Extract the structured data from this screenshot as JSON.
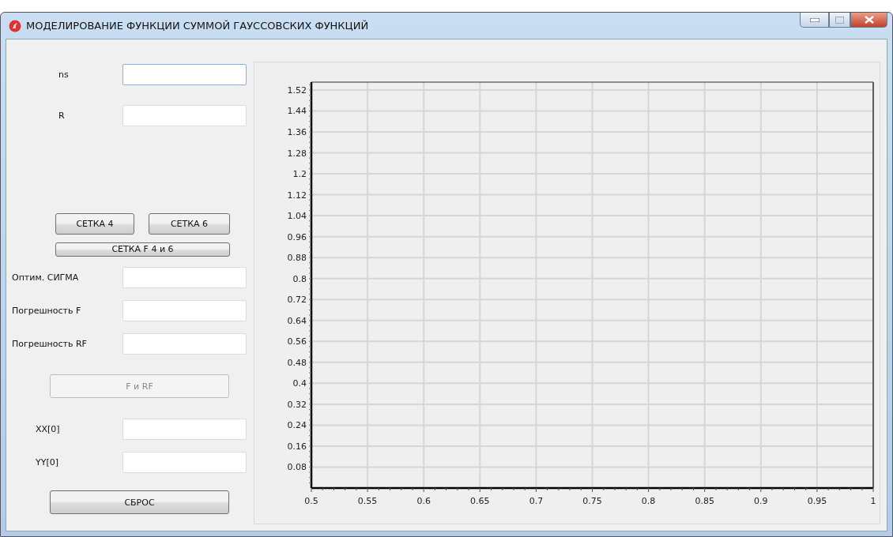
{
  "window": {
    "title": "МОДЕЛИРОВАНИЕ ФУНКЦИИ СУММОЙ ГАУССОВСКИХ ФУНКЦИЙ"
  },
  "controls": [
    {
      "kind": "field",
      "label": "ns",
      "focused": true
    },
    {
      "kind": "field",
      "label": "R",
      "focused": false
    },
    {
      "kind": "spacer"
    },
    {
      "kind": "button_pair",
      "buttons": [
        {
          "label": "СЕТКА 4",
          "disabled": false
        },
        {
          "label": "СЕТКА 6",
          "disabled": false
        }
      ]
    },
    {
      "kind": "thin_button",
      "label": "СЕТКА F 4 и 6",
      "disabled": false
    },
    {
      "kind": "field",
      "label": "Оптим. СИГМА",
      "focused": false
    },
    {
      "kind": "field",
      "label": "Погрешность F",
      "focused": false
    },
    {
      "kind": "field",
      "label": "Погрешность RF",
      "focused": false
    },
    {
      "kind": "button",
      "label": "F и RF",
      "disabled": true
    },
    {
      "kind": "field",
      "label": "XX[0]",
      "focused": false
    },
    {
      "kind": "field",
      "label": "YY[0]",
      "focused": false
    },
    {
      "kind": "button",
      "label": "СБРОС",
      "disabled": false
    }
  ],
  "chart": {
    "chart_data": {
      "type": "line",
      "grid": true,
      "xlim": [
        0.5,
        1
      ],
      "ylim": [
        0,
        1.55
      ],
      "xticks": [
        {
          "value": 0.5,
          "label": "0.5"
        },
        {
          "value": 0.55,
          "label": "0.55"
        },
        {
          "value": 0.6,
          "label": "0.6"
        },
        {
          "value": 0.65,
          "label": "0.65"
        },
        {
          "value": 0.7,
          "label": "0.7"
        },
        {
          "value": 0.75,
          "label": "0.75"
        },
        {
          "value": 0.8,
          "label": "0.8"
        },
        {
          "value": 0.85,
          "label": "0.85"
        },
        {
          "value": 0.9,
          "label": "0.9"
        },
        {
          "value": 0.95,
          "label": "0.95"
        },
        {
          "value": 1,
          "label": "1"
        }
      ],
      "yticks": [
        {
          "value": 0.08,
          "label": "0.08"
        },
        {
          "value": 0.16,
          "label": "0.16"
        },
        {
          "value": 0.24,
          "label": "0.24"
        },
        {
          "value": 0.32,
          "label": "0.32"
        },
        {
          "value": 0.4,
          "label": "0.4"
        },
        {
          "value": 0.48,
          "label": "0.48"
        },
        {
          "value": 0.56,
          "label": "0.56"
        },
        {
          "value": 0.64,
          "label": "0.64"
        },
        {
          "value": 0.72,
          "label": "0.72"
        },
        {
          "value": 0.8,
          "label": "0.8"
        },
        {
          "value": 0.88,
          "label": "0.88"
        },
        {
          "value": 0.96,
          "label": "0.96"
        },
        {
          "value": 1.04,
          "label": "1.04"
        },
        {
          "value": 1.12,
          "label": "1.12"
        },
        {
          "value": 1.2,
          "label": "1.2"
        },
        {
          "value": 1.28,
          "label": "1.28"
        },
        {
          "value": 1.36,
          "label": "1.36"
        },
        {
          "value": 1.44,
          "label": "1.44"
        },
        {
          "value": 1.52,
          "label": "1.52"
        }
      ]
    }
  }
}
